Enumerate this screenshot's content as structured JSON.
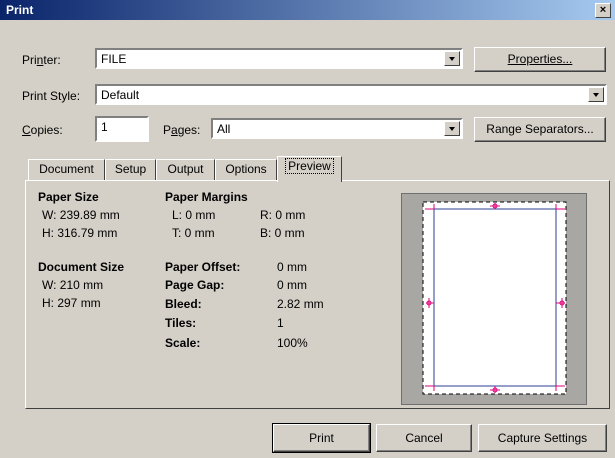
{
  "window": {
    "title": "Print",
    "close_glyph": "×"
  },
  "printer": {
    "label_pre": "Pri",
    "label_ul": "n",
    "label_post": "ter:",
    "value": "FILE",
    "properties_label": "Properties..."
  },
  "print_style": {
    "label_pre": "Print",
    "label_ul": "",
    "label_post": " Style:",
    "value": "Default"
  },
  "copies": {
    "label_ul": "C",
    "label_post": "opies:",
    "value": "1"
  },
  "pages": {
    "label_pre": "P",
    "label_ul": "a",
    "label_post": "ges:",
    "value": "All"
  },
  "range_separators_label": "Range Separators...",
  "tabs": [
    {
      "label": "Document"
    },
    {
      "label": "Setup"
    },
    {
      "label": "Output"
    },
    {
      "label": "Options"
    },
    {
      "label": "Preview",
      "active": true
    }
  ],
  "preview": {
    "paper_size": {
      "heading": "Paper Size",
      "w": "W: 239.89 mm",
      "h": "H: 316.79 mm"
    },
    "paper_margins": {
      "heading": "Paper Margins",
      "l": "L: 0 mm",
      "r": "R: 0 mm",
      "t": "T: 0 mm",
      "b": "B: 0 mm"
    },
    "document_size": {
      "heading": "Document Size",
      "w": "W: 210 mm",
      "h": "H: 297 mm"
    },
    "details": [
      {
        "label": "Paper Offset:",
        "value": "0 mm"
      },
      {
        "label": "Page Gap:",
        "value": "0 mm"
      },
      {
        "label": "Bleed:",
        "value": "2.82 mm"
      },
      {
        "label": "Tiles:",
        "value": "1"
      },
      {
        "label": "Scale:",
        "value": "100%"
      }
    ]
  },
  "buttons": {
    "print": "Print",
    "cancel": "Cancel",
    "capture": "Capture Settings"
  },
  "colors": {
    "title_start": "#0a246a",
    "title_end": "#a6caf0",
    "dialog_bg": "#d4d0c8",
    "crop_marks": "#e0007a",
    "page_border": "#2b3f8f"
  }
}
